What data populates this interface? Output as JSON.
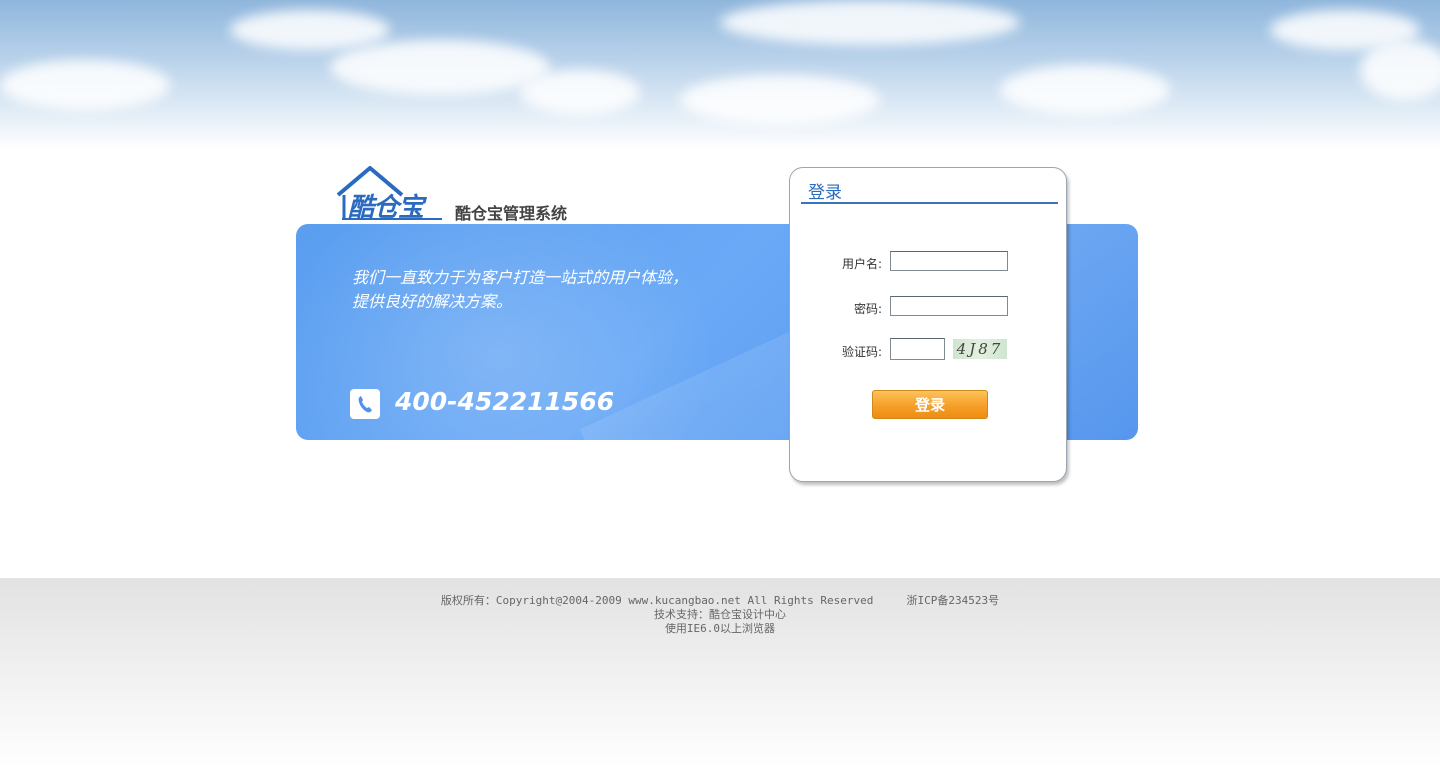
{
  "brand": {
    "logo_text": "酷仓宝",
    "system_title": "酷仓宝管理系统"
  },
  "banner": {
    "slogan_line1": "我们一直致力于为客户打造一站式的用户体验，",
    "slogan_line2": "提供良好的解决方案。",
    "phone": "400-452211566",
    "color": "#5a9ef0"
  },
  "login": {
    "title": "登录",
    "username_label": "用户名:",
    "username_value": "",
    "password_label": "密码:",
    "password_value": "",
    "captcha_label": "验证码:",
    "captcha_value": "",
    "captcha_image_text": "4J87",
    "submit_label": "登录",
    "accent": "#2a6bbf",
    "button_color": "#f6a22c"
  },
  "footer": {
    "copyright": "版权所有：Copyright@2004-2009 www.kucangbao.net All Rights Reserved     浙ICP备234523号",
    "support": "技术支持：酷仓宝设计中心",
    "browser": "使用IE6.0以上浏览器"
  }
}
